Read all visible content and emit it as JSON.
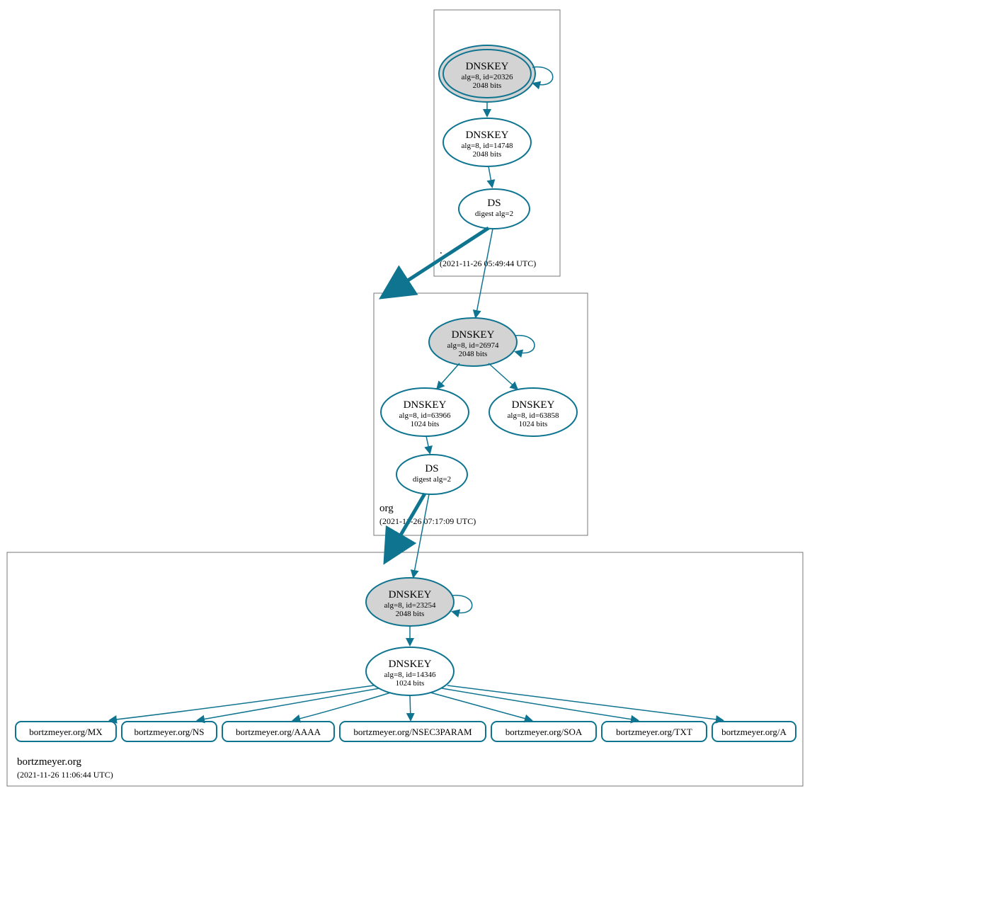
{
  "zones": {
    "root": {
      "name": ".",
      "timestamp": "(2021-11-26 05:49:44 UTC)",
      "ksk": {
        "title": "DNSKEY",
        "line2": "alg=8, id=20326",
        "line3": "2048 bits"
      },
      "zsk": {
        "title": "DNSKEY",
        "line2": "alg=8, id=14748",
        "line3": "2048 bits"
      },
      "ds": {
        "title": "DS",
        "line2": "digest alg=2"
      }
    },
    "org": {
      "name": "org",
      "timestamp": "(2021-11-26 07:17:09 UTC)",
      "ksk": {
        "title": "DNSKEY",
        "line2": "alg=8, id=26974",
        "line3": "2048 bits"
      },
      "zsk1": {
        "title": "DNSKEY",
        "line2": "alg=8, id=63966",
        "line3": "1024 bits"
      },
      "zsk2": {
        "title": "DNSKEY",
        "line2": "alg=8, id=63858",
        "line3": "1024 bits"
      },
      "ds": {
        "title": "DS",
        "line2": "digest alg=2"
      }
    },
    "domain": {
      "name": "bortzmeyer.org",
      "timestamp": "(2021-11-26 11:06:44 UTC)",
      "ksk": {
        "title": "DNSKEY",
        "line2": "alg=8, id=23254",
        "line3": "2048 bits"
      },
      "zsk": {
        "title": "DNSKEY",
        "line2": "alg=8, id=14346",
        "line3": "1024 bits"
      },
      "records": [
        "bortzmeyer.org/MX",
        "bortzmeyer.org/NS",
        "bortzmeyer.org/AAAA",
        "bortzmeyer.org/NSEC3PARAM",
        "bortzmeyer.org/SOA",
        "bortzmeyer.org/TXT",
        "bortzmeyer.org/A"
      ]
    }
  },
  "colors": {
    "accent": "#0e7490",
    "ksk_fill": "#d3d3d3"
  }
}
